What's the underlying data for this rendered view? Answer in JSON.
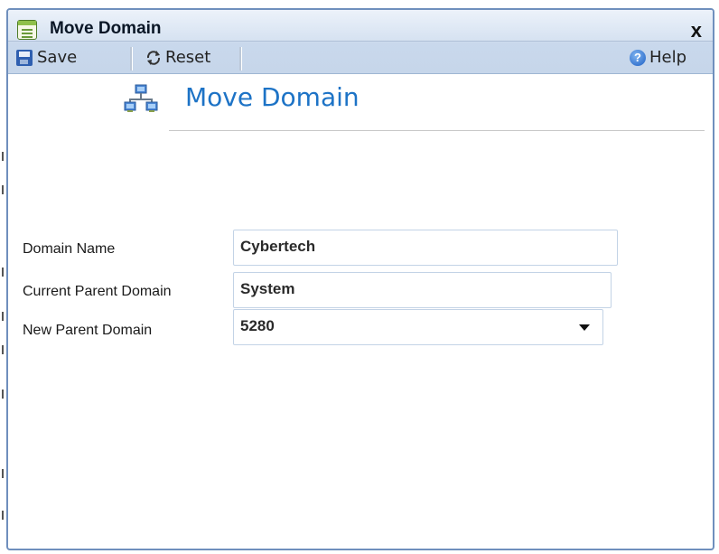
{
  "window": {
    "title": "Move Domain",
    "close_label": "x"
  },
  "toolbar": {
    "save_label": "Save",
    "reset_label": "Reset",
    "help_label": "Help"
  },
  "header": {
    "title": "Move Domain",
    "icon": "network-computers-icon"
  },
  "form": {
    "domain_name": {
      "label": "Domain Name",
      "value": "Cybertech"
    },
    "current_parent": {
      "label": "Current Parent Domain",
      "value": "System"
    },
    "new_parent": {
      "label": "New Parent Domain",
      "value": "5280"
    }
  },
  "colors": {
    "accent_title": "#1d73c6",
    "titlebar": "#d6e2f1",
    "border": "#6f8fbd"
  }
}
